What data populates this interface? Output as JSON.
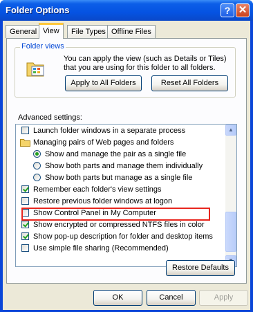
{
  "window": {
    "title": "Folder Options"
  },
  "titlebar": {
    "help_glyph": "?",
    "close_glyph": "✕"
  },
  "tabs": [
    {
      "label": "General"
    },
    {
      "label": "View"
    },
    {
      "label": "File Types"
    },
    {
      "label": "Offline Files"
    }
  ],
  "folder_views": {
    "group_label": "Folder views",
    "description": "You can apply the view (such as Details or Tiles) that you are using for this folder to all folders.",
    "apply_button": "Apply to All Folders",
    "reset_button": "Reset All Folders",
    "icon": "folder-views-icon"
  },
  "advanced": {
    "label": "Advanced settings:",
    "items": [
      {
        "type": "checkbox",
        "label": "Launch folder windows in a separate process",
        "checked": false
      },
      {
        "type": "folder",
        "label": "Managing pairs of Web pages and folders"
      },
      {
        "type": "radio",
        "label": "Show and manage the pair as a single file",
        "checked": true
      },
      {
        "type": "radio",
        "label": "Show both parts and manage them individually",
        "checked": false
      },
      {
        "type": "radio",
        "label": "Show both parts but manage as a single file",
        "checked": false
      },
      {
        "type": "checkbox",
        "label": "Remember each folder's view settings",
        "checked": true
      },
      {
        "type": "checkbox",
        "label": "Restore previous folder windows at logon",
        "checked": false
      },
      {
        "type": "checkbox",
        "label": "Show Control Panel in My Computer",
        "checked": false
      },
      {
        "type": "checkbox",
        "label": "Show encrypted or compressed NTFS files in color",
        "checked": true
      },
      {
        "type": "checkbox",
        "label": "Show pop-up description for folder and desktop items",
        "checked": true
      },
      {
        "type": "checkbox",
        "label": "Use simple file sharing (Recommended)",
        "checked": false
      }
    ]
  },
  "restore_defaults_button": "Restore Defaults",
  "footer": {
    "ok": "OK",
    "cancel": "Cancel",
    "apply": "Apply"
  },
  "colors": {
    "title_blue": "#0553e2",
    "highlight_red": "#e8261e",
    "group_label": "#0046d5"
  }
}
